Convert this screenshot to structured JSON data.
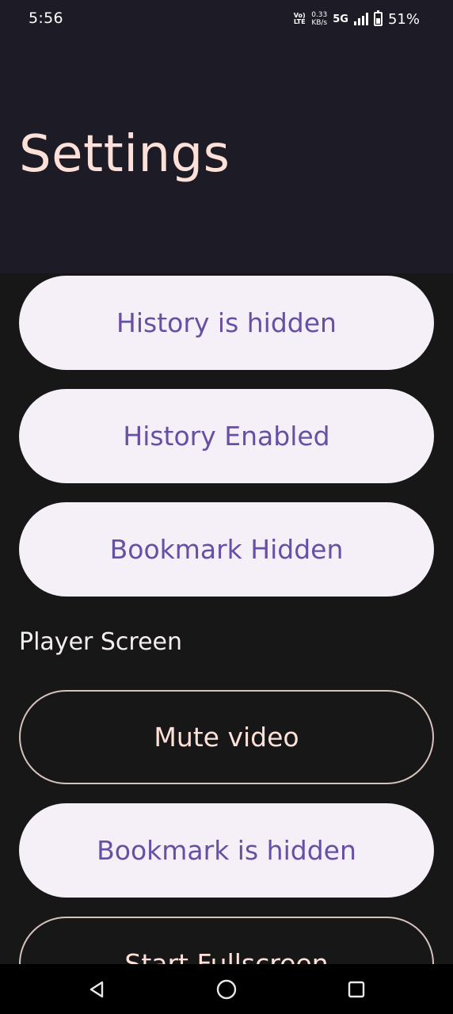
{
  "status_bar": {
    "time": "5:56",
    "volte_line1": "Vo)",
    "volte_line2": "LTE",
    "net_speed_value": "0.33",
    "net_speed_unit": "KB/s",
    "network": "5G",
    "battery": "51%",
    "battery_level": 0.51
  },
  "header": {
    "title": "Settings"
  },
  "settings": {
    "history_hidden_label": "History is hidden",
    "history_enabled_label": "History Enabled",
    "bookmark_hidden_label": "Bookmark Hidden",
    "player_section_label": "Player Screen",
    "mute_video_label": "Mute video",
    "bookmark_is_hidden_label": "Bookmark is hidden",
    "start_fullscreen_label": "Start Fullscreen"
  },
  "nav_bar": {
    "icons": [
      "back-icon",
      "home-icon",
      "recents-icon"
    ]
  },
  "colors": {
    "header_bg": "#1d1c26",
    "content_bg": "#171717",
    "title": "#fde1d8",
    "pill_fill": "#f5eff8",
    "pill_text": "#6750a4",
    "outline": "#d6c2bd"
  }
}
